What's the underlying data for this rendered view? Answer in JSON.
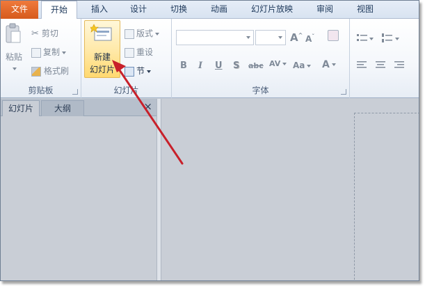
{
  "tabs": [
    {
      "label": "文件",
      "key": "file"
    },
    {
      "label": "开始",
      "key": "home",
      "active": true
    },
    {
      "label": "插入",
      "key": "insert"
    },
    {
      "label": "设计",
      "key": "design"
    },
    {
      "label": "切换",
      "key": "transitions"
    },
    {
      "label": "动画",
      "key": "animations"
    },
    {
      "label": "幻灯片放映",
      "key": "slideshow"
    },
    {
      "label": "审阅",
      "key": "review"
    },
    {
      "label": "视图",
      "key": "view"
    }
  ],
  "clipboard": {
    "group_label": "剪贴板",
    "paste_label": "粘贴",
    "cut_label": "剪切",
    "copy_label": "复制",
    "format_painter_label": "格式刷"
  },
  "slides": {
    "group_label": "幻灯片",
    "new_slide_line1": "新建",
    "new_slide_line2": "幻灯片",
    "layout_label": "版式",
    "reset_label": "重设",
    "section_label": "节"
  },
  "font": {
    "group_label": "字体",
    "font_name_value": "",
    "font_size_value": "",
    "grow_label": "A",
    "shrink_label": "A",
    "bold_label": "B",
    "italic_label": "I",
    "underline_label": "U",
    "shadow_label": "S",
    "strike_label": "abc",
    "spacing_label": "AV",
    "case_label": "Aa",
    "color_label": "A"
  },
  "pane": {
    "slides_tab_label": "幻灯片",
    "outline_tab_label": "大纲",
    "close_label": "×"
  },
  "colors": {
    "file_tab": "#e0682a",
    "annotation_arrow": "#c8202a",
    "new_slide_highlight": "#ffe08a"
  },
  "icons": [
    "paste-icon",
    "cut-icon",
    "copy-icon",
    "format-painter-icon",
    "new-slide-icon",
    "layout-icon",
    "reset-icon",
    "section-icon",
    "clear-format-icon",
    "bullets-icon",
    "numbering-icon",
    "align-left-icon",
    "align-center-icon",
    "align-right-icon"
  ]
}
